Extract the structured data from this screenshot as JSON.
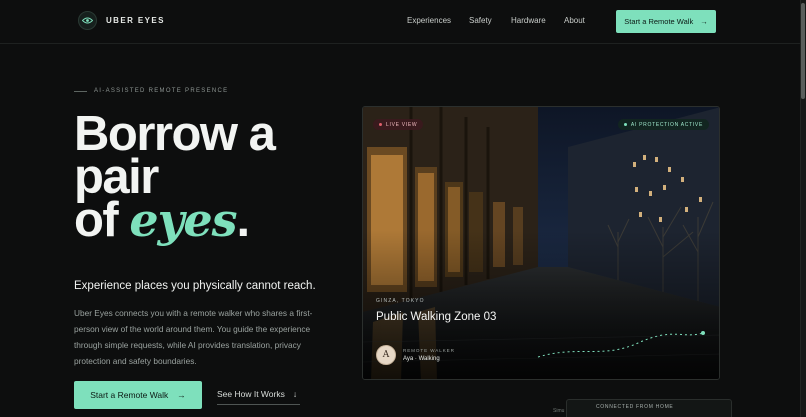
{
  "brand": {
    "name": "UBER EYES"
  },
  "nav": {
    "links": [
      "Experiences",
      "Safety",
      "Hardware",
      "About"
    ],
    "cta": "Start a Remote Walk"
  },
  "hero": {
    "eyebrow": "AI-ASSISTED REMOTE PRESENCE",
    "headline": {
      "line1": "Borrow a",
      "line2": "pair",
      "line3_prefix": "of ",
      "line3_accent": "eyes",
      "line3_suffix": "."
    },
    "subhead": "Experience places you physically cannot reach.",
    "body": "Uber Eyes connects you with a remote walker who shares a first-person view of the world around them. You guide the experience through simple requests, while AI provides translation, privacy protection and safety boundaries.",
    "primary_cta": "Start a Remote Walk",
    "secondary_cta": "See How It Works"
  },
  "feed": {
    "live_badge": "LIVE VIEW",
    "ai_badge": "AI PROTECTION ACTIVE",
    "location": "GINZA, TOKYO",
    "title": "Public Walking Zone 03",
    "walker_initial": "A",
    "walker_role": "REMOTE WALKER",
    "walker_name": "Aya · Walking"
  },
  "connected_panel": {
    "label": "CONNECTED FROM HOME",
    "side_text": "Simu"
  },
  "colors": {
    "accent": "#7ee0bc",
    "background": "#0d0e0e",
    "live": "#e0606c"
  },
  "icons": [
    "eye-icon",
    "arrow-right-icon",
    "arrow-down-icon"
  ]
}
